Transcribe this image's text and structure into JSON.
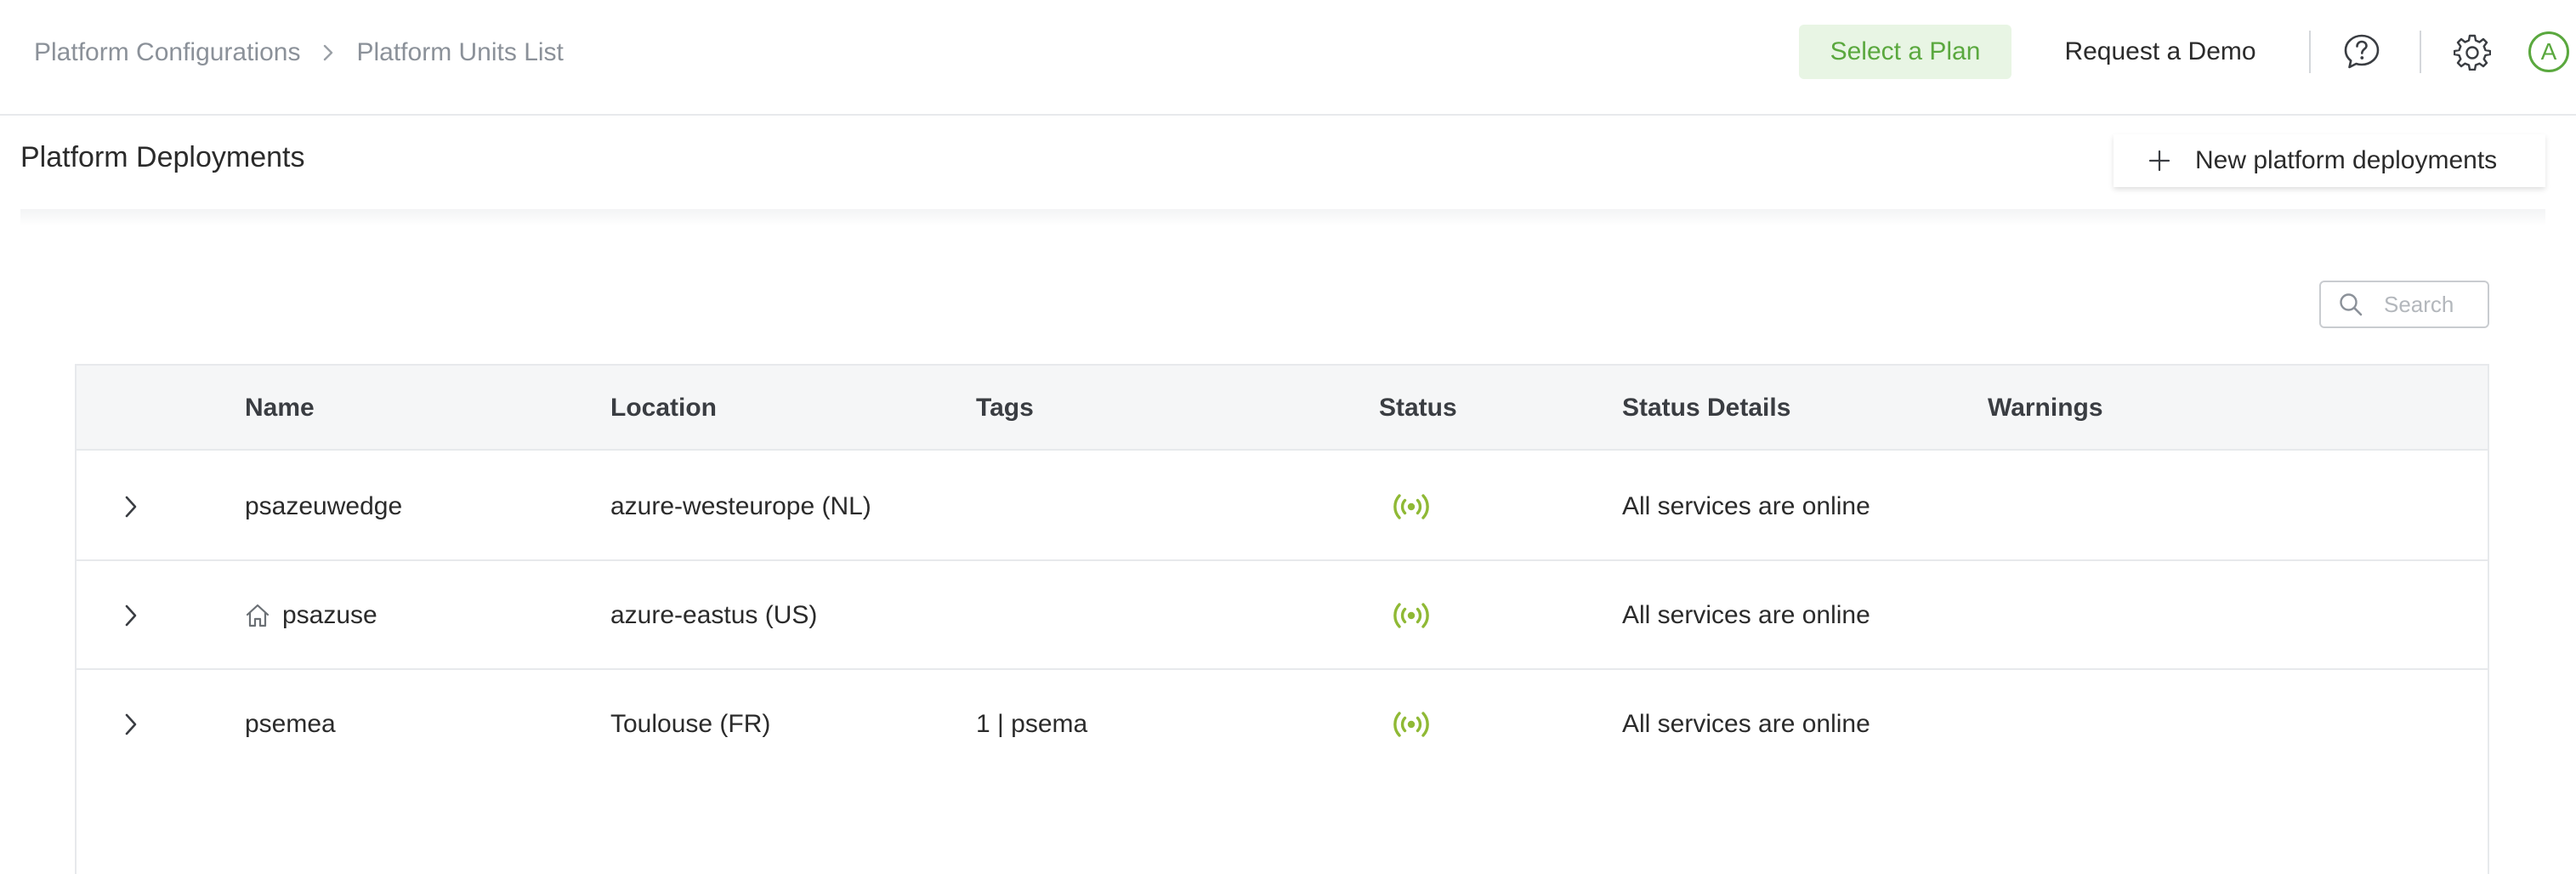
{
  "breadcrumb": {
    "items": [
      "Platform Configurations",
      "Platform Units List"
    ]
  },
  "topbar": {
    "select_plan": "Select a Plan",
    "request_demo": "Request a Demo",
    "avatar_initial": "A",
    "icons": [
      "help-icon",
      "gear-icon"
    ]
  },
  "page": {
    "title": "Platform Deployments",
    "new_button_label": "New platform deployments"
  },
  "search": {
    "placeholder": "Search",
    "value": ""
  },
  "table": {
    "columns": [
      "Name",
      "Location",
      "Tags",
      "Status",
      "Status Details",
      "Warnings"
    ],
    "rows": [
      {
        "name": "psazeuwedge",
        "home": false,
        "location": "azure-westeurope (NL)",
        "tags": "",
        "status_icon": "online-broadcast-icon",
        "status_details": "All services are online",
        "warnings": ""
      },
      {
        "name": "psazuse",
        "home": true,
        "location": "azure-eastus (US)",
        "tags": "",
        "status_icon": "online-broadcast-icon",
        "status_details": "All services are online",
        "warnings": ""
      },
      {
        "name": "psemea",
        "home": false,
        "location": "Toulouse (FR)",
        "tags": "1 | psema",
        "status_icon": "online-broadcast-icon",
        "status_details": "All services are online",
        "warnings": ""
      }
    ]
  },
  "colors": {
    "accent_green": "#5aa83e",
    "status_online": "#8fb935",
    "header_bg": "#f5f6f7",
    "border": "#e7e9ec"
  }
}
